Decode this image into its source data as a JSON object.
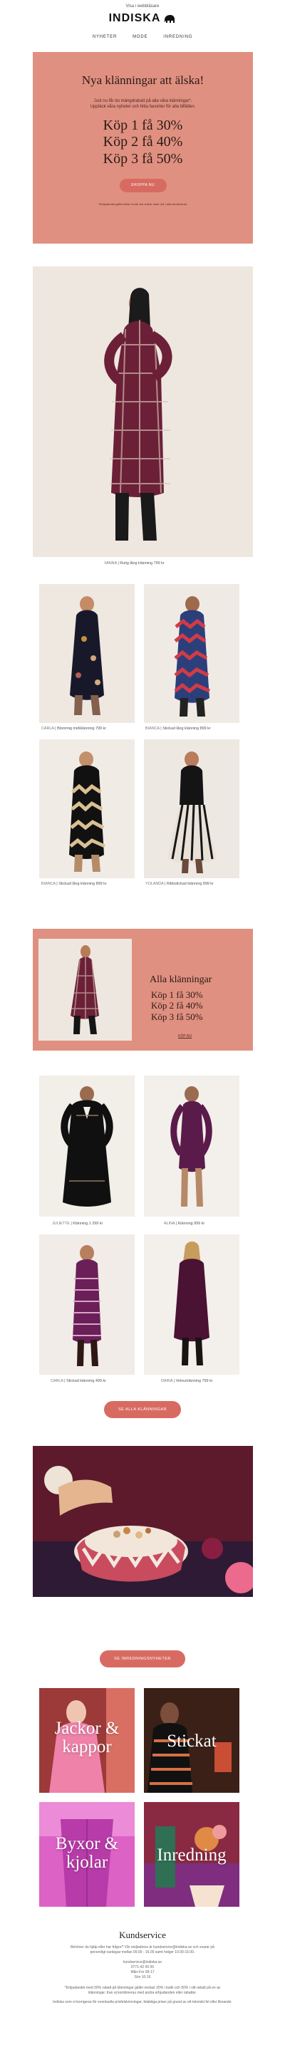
{
  "header": {
    "browser_link": "Visa i webbläsare",
    "brand": "INDISKA",
    "nav": [
      "NYHETER",
      "MODE",
      "INREDNING"
    ]
  },
  "hero": {
    "title": "Nya klänningar att älska!",
    "intro_line1": "Just nu får du mängdrabatt på alla våra klänningar*.",
    "intro_line2": "Upptäck våra nyheter och hitta favoriter för alla tillfällen.",
    "offers": [
      "Köp 1 få 30%",
      "Köp 2 få 40%",
      "Köp 3 få 50%"
    ],
    "button": "SHOPPA NU",
    "footnote": "*Erbjudandet gäller både i butik och online, löser 4/4 i alla medlemmar."
  },
  "main_product": {
    "name": "VANNA",
    "desc": "Rutig lång klänning 799 kr"
  },
  "grid1": [
    {
      "name": "CARLA",
      "desc": "Blommig midiklänning 799 kr"
    },
    {
      "name": "BIANCA",
      "desc": "Stickad lång klänning 899 kr"
    },
    {
      "name": "BIANCA",
      "desc": "Stickad lång klänning 899 kr"
    },
    {
      "name": "YOLANDA",
      "desc": "Ribbstickad klänning 899 kr"
    }
  ],
  "promo": {
    "title": "Alla klänningar",
    "lines": [
      "Köp 1 få 30%",
      "Köp 2 få 40%",
      "Köp 3 få 50%"
    ],
    "cta": "KÖP NU"
  },
  "grid2": [
    {
      "name": "JULIETTE",
      "desc": "Klänning 1 299 kr"
    },
    {
      "name": "ALINA",
      "desc": "Klänning 999 kr"
    },
    {
      "name": "CARLA",
      "desc": "Stickad klänning 499 kr"
    },
    {
      "name": "DARIA",
      "desc": "Velourklänning 799 kr"
    }
  ],
  "buttons": {
    "all_dresses": "SE ALLA KLÄNNINGAR",
    "home_news": "SE INREDNINGSNYHETER"
  },
  "categories": [
    "Jackor & kappor",
    "Stickat",
    "Byxor & kjolar",
    "Inredning"
  ],
  "service": {
    "title": "Kundservice",
    "line1": "Behöver du hjälp eller har frågor? Vår mejladress är kundservice@indiska.se och svarar på",
    "line2": "personligt vardagar mellan 09.00 - 16.00 samt helger 10.00-15.00.",
    "email": "kundservice@indiska.se",
    "phone": "0771-42 00 00",
    "hours": "Mån-Fre 09-17",
    "sat": "Sön 10-16",
    "legal1": "*Erbjudandet med 30% rabatt på klänningar gäller endast 30% i butik och 50% i sitt rabatt på en av",
    "legal2": "klänningar. Kan ej kombineras med andra erbjudanden eller rabatter.",
    "legal3": "Indiska som vi korrigerar för eventuella prisfelskrivningar, felaktiga priser på grund av ett tekniskt fel eller liknande."
  }
}
